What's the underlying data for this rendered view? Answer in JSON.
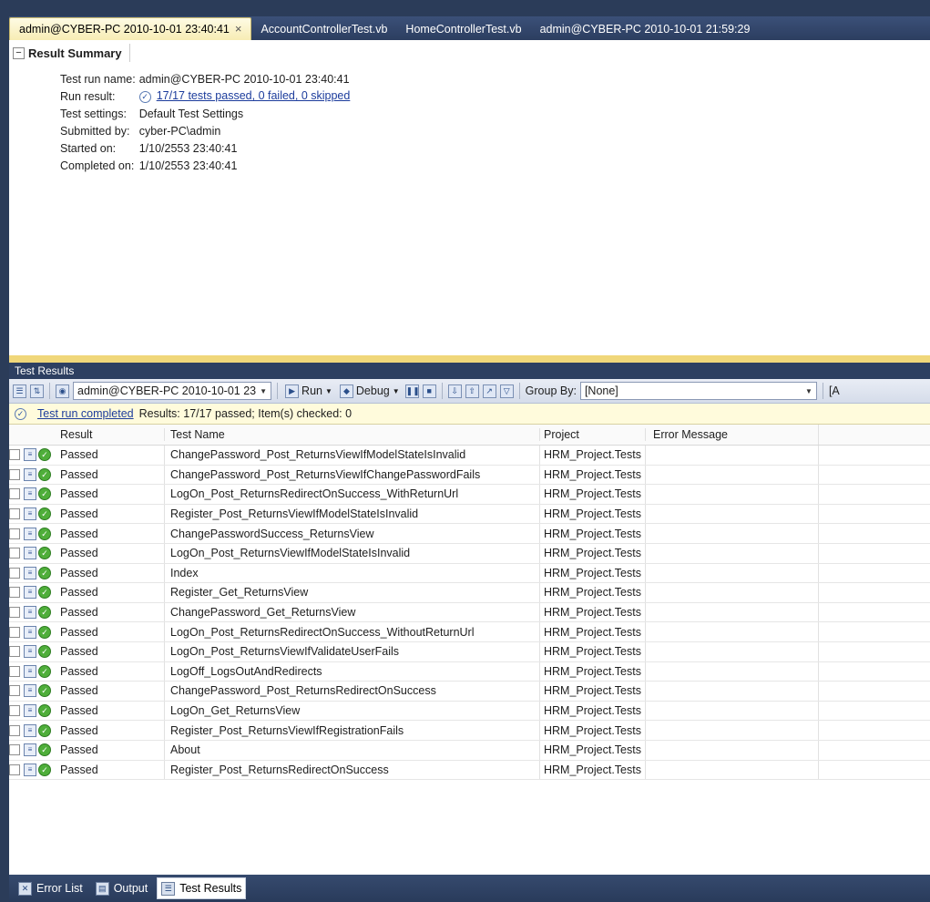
{
  "tabs": [
    {
      "label": "admin@CYBER-PC 2010-10-01 23:40:41",
      "active": true,
      "close": "×"
    },
    {
      "label": "AccountControllerTest.vb",
      "active": false
    },
    {
      "label": "HomeControllerTest.vb",
      "active": false
    },
    {
      "label": "admin@CYBER-PC 2010-10-01 21:59:29",
      "active": false
    }
  ],
  "summary": {
    "toggle": "−",
    "header": "Result Summary",
    "rows": [
      {
        "label": "Test run name:",
        "value": "admin@CYBER-PC 2010-10-01 23:40:41"
      },
      {
        "label": "Run result:",
        "value": "17/17 tests passed, 0 failed, 0 skipped"
      },
      {
        "label": "Test settings:",
        "value": "Default Test Settings"
      },
      {
        "label": "Submitted by:",
        "value": "cyber-PC\\admin"
      },
      {
        "label": "Started on:",
        "value": "1/10/2553 23:40:41"
      },
      {
        "label": "Completed on:",
        "value": "1/10/2553 23:40:41"
      }
    ]
  },
  "panel": {
    "title": "Test Results",
    "toolbar": {
      "run_combo": "admin@CYBER-PC 2010-10-01 23",
      "run_label": "Run",
      "debug_label": "Debug",
      "group_by_label": "Group By:",
      "group_by_value": "[None]",
      "trailing": "[A"
    },
    "status": {
      "link": "Test run completed",
      "text": "Results: 17/17 passed;  Item(s) checked: 0"
    },
    "columns": [
      "Result",
      "Test Name",
      "Project",
      "Error Message"
    ],
    "rows": [
      {
        "result": "Passed",
        "name": "ChangePassword_Post_ReturnsViewIfModelStateIsInvalid",
        "project": "HRM_Project.Tests",
        "error": ""
      },
      {
        "result": "Passed",
        "name": "ChangePassword_Post_ReturnsViewIfChangePasswordFails",
        "project": "HRM_Project.Tests",
        "error": ""
      },
      {
        "result": "Passed",
        "name": "LogOn_Post_ReturnsRedirectOnSuccess_WithReturnUrl",
        "project": "HRM_Project.Tests",
        "error": ""
      },
      {
        "result": "Passed",
        "name": "Register_Post_ReturnsViewIfModelStateIsInvalid",
        "project": "HRM_Project.Tests",
        "error": ""
      },
      {
        "result": "Passed",
        "name": "ChangePasswordSuccess_ReturnsView",
        "project": "HRM_Project.Tests",
        "error": ""
      },
      {
        "result": "Passed",
        "name": "LogOn_Post_ReturnsViewIfModelStateIsInvalid",
        "project": "HRM_Project.Tests",
        "error": ""
      },
      {
        "result": "Passed",
        "name": "Index",
        "project": "HRM_Project.Tests",
        "error": ""
      },
      {
        "result": "Passed",
        "name": "Register_Get_ReturnsView",
        "project": "HRM_Project.Tests",
        "error": ""
      },
      {
        "result": "Passed",
        "name": "ChangePassword_Get_ReturnsView",
        "project": "HRM_Project.Tests",
        "error": ""
      },
      {
        "result": "Passed",
        "name": "LogOn_Post_ReturnsRedirectOnSuccess_WithoutReturnUrl",
        "project": "HRM_Project.Tests",
        "error": ""
      },
      {
        "result": "Passed",
        "name": "LogOn_Post_ReturnsViewIfValidateUserFails",
        "project": "HRM_Project.Tests",
        "error": ""
      },
      {
        "result": "Passed",
        "name": "LogOff_LogsOutAndRedirects",
        "project": "HRM_Project.Tests",
        "error": ""
      },
      {
        "result": "Passed",
        "name": "ChangePassword_Post_ReturnsRedirectOnSuccess",
        "project": "HRM_Project.Tests",
        "error": ""
      },
      {
        "result": "Passed",
        "name": "LogOn_Get_ReturnsView",
        "project": "HRM_Project.Tests",
        "error": ""
      },
      {
        "result": "Passed",
        "name": "Register_Post_ReturnsViewIfRegistrationFails",
        "project": "HRM_Project.Tests",
        "error": ""
      },
      {
        "result": "Passed",
        "name": "About",
        "project": "HRM_Project.Tests",
        "error": ""
      },
      {
        "result": "Passed",
        "name": "Register_Post_ReturnsRedirectOnSuccess",
        "project": "HRM_Project.Tests",
        "error": ""
      }
    ]
  },
  "bottom_tabs": [
    {
      "label": "Error List",
      "icon": "error-list-icon",
      "active": false
    },
    {
      "label": "Output",
      "icon": "output-icon",
      "active": false
    },
    {
      "label": "Test Results",
      "icon": "test-results-icon",
      "active": true
    }
  ],
  "colors": {
    "chrome": "#2b3c59",
    "active_tab": "#fefbe4",
    "status_bar": "#fffbdc",
    "pass": "#4fae3a",
    "link": "#1c3c9c"
  }
}
